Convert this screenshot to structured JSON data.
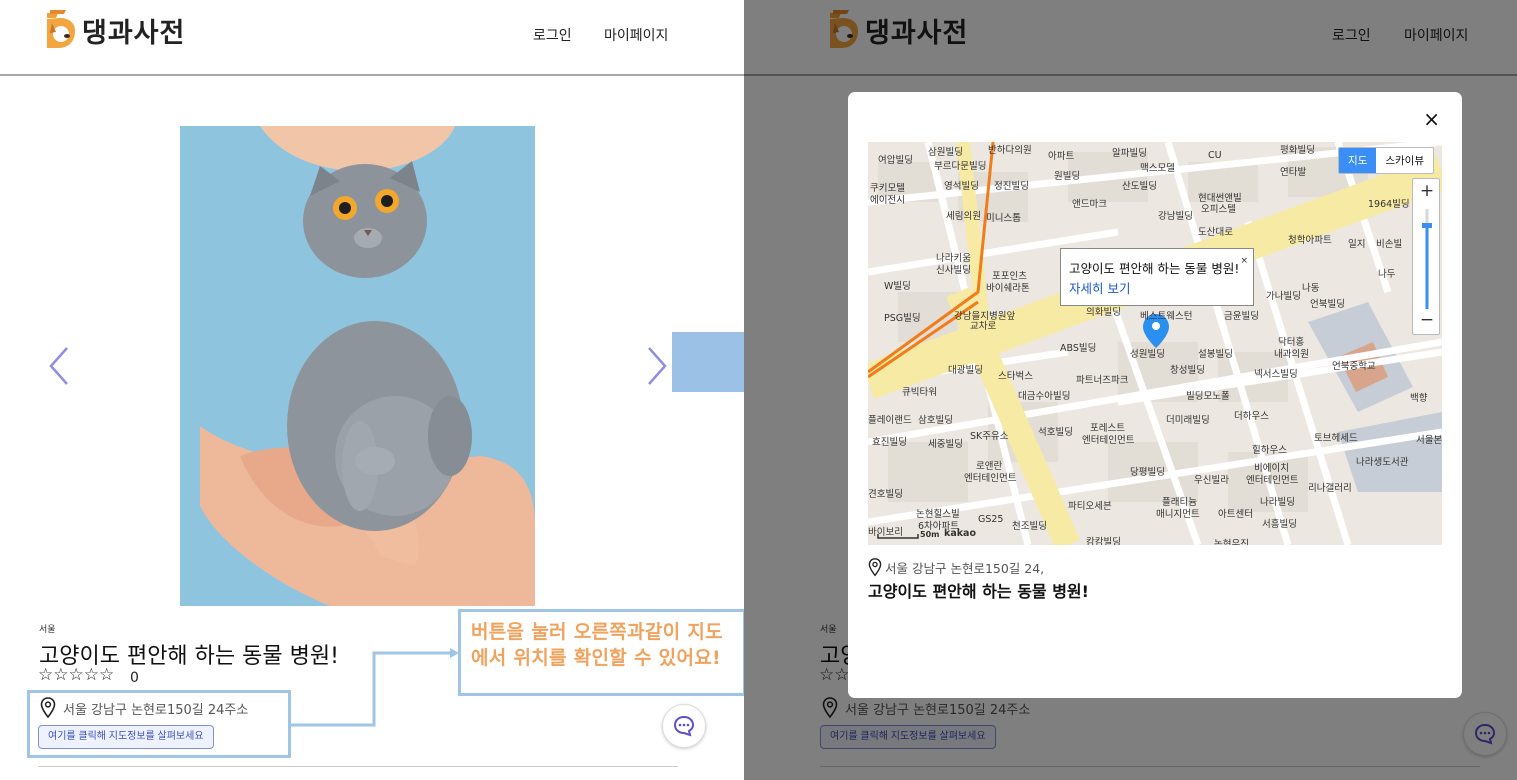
{
  "brand": {
    "name": "댕과사전"
  },
  "nav": {
    "login": "로그인",
    "mypage": "마이페이지"
  },
  "listing": {
    "region": "서울",
    "title": "고양이도 편안해 하는 동물 병원!",
    "stars": "☆☆☆☆☆",
    "rating_count": "0",
    "address": "서울 강남구 논현로150길 24주소",
    "map_button": "여기를 클릭해 지도정보를 살펴보세요"
  },
  "annotation": {
    "text": "버튼을 눌러 오른쪽과같이 지도에서 위치를 확인할 수 있어요!"
  },
  "modal": {
    "close": "×",
    "address": "서울 강남구 논현로150길 24,",
    "title": "고양이도 편안해 하는 동물 병원!",
    "map": {
      "type_map": "지도",
      "type_sky": "스카이뷰",
      "zoom_in": "+",
      "zoom_out": "−",
      "scale": "50m",
      "provider": "kakao",
      "tooltip_title": "고양이도 편안해 하는 동물 병원!",
      "tooltip_link": "자세히 보기",
      "tooltip_close": "×",
      "labels": [
        "삼원빌딩",
        "반하다의원",
        "알파빌딩",
        "평화빌딩",
        "여압빌딩",
        "부르다문빌딩",
        "아파트",
        "맥스모델",
        "CU",
        "연타발",
        "쿠키모텔",
        "에이전시",
        "영석빌딩",
        "정진빌딩",
        "원빌딩",
        "산도빌딩",
        "현대썬앤빌",
        "오피스텔",
        "1964빌딩",
        "세림의원",
        "미니스톱",
        "앤드마크",
        "강남빌딩",
        "도산대로",
        "청학아파트",
        "일지",
        "비손빌",
        "나라키움",
        "신사빌딩",
        "포포인츠",
        "바이쉐라톤",
        "나두",
        "W빌딩",
        "가나빌딩",
        "언북빌딩",
        "나동",
        "PSG빌딩",
        "강남을지병원앞",
        "교차로",
        "의화빌딩",
        "베스트웨스턴",
        "금윤빌딩",
        "트리",
        "ABS빌딩",
        "성원빌딩",
        "설봉빌딩",
        "닥터홍",
        "내과의원",
        "대광빌딩",
        "스타벅스",
        "창성빌딩",
        "넥서스빌딩",
        "언북중학교",
        "파트너즈파크",
        "큐빅타워",
        "대금수아빌딩",
        "빌딩모노폴",
        "백향",
        "플레이랜드",
        "삼호빌딩",
        "포레스트",
        "엔터테인먼트",
        "더미래빌딩",
        "더하우스",
        "효진빌딩",
        "세중빌딩",
        "SK주유소",
        "석호빌딩",
        "힐하우스",
        "토브헤세드",
        "서울본",
        "로앤란",
        "엔터테인먼트",
        "당평빌딩",
        "우신빌라",
        "비에이치",
        "엔터테인먼트",
        "나라생도서관",
        "리나갤러리",
        "견호빌딩",
        "파티오세븐",
        "나라빌딩",
        "논현힐스빌",
        "6차아파트",
        "GS25",
        "천조빌딩",
        "플래티늄",
        "매니지먼트",
        "아트센터",
        "서흥빌딩",
        "바이보리",
        "캄캄빌딩",
        "논현우진"
      ]
    }
  }
}
